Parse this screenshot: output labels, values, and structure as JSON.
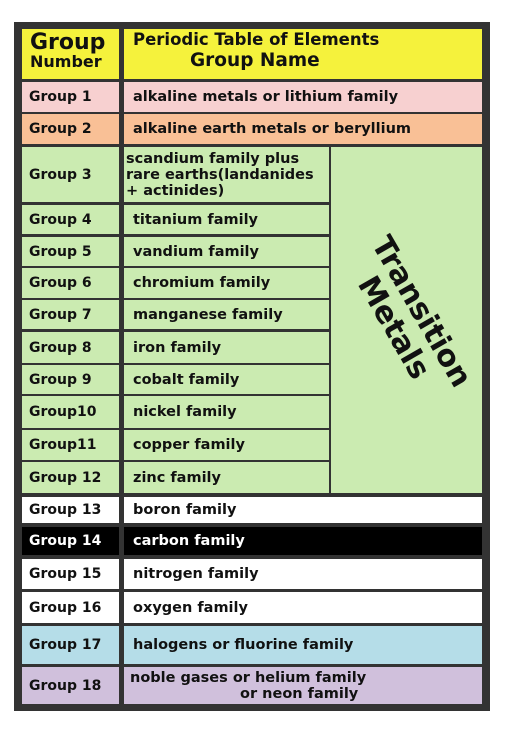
{
  "header": {
    "left_line1": "Group",
    "left_line2": "Number",
    "right_line1": "Periodic Table of Elements",
    "right_line2": "Group Name"
  },
  "transition_label": {
    "line1": "Transition",
    "line2": "Metals"
  },
  "colors": {
    "header": "#f5f23c",
    "group1": "#f7d0d0",
    "group2": "#f9c096",
    "transition": "#cbebb1",
    "white": "#ffffff",
    "group14": "#000000",
    "group17": "#b5dde8",
    "group18": "#d0c0dc",
    "frame": "#333333"
  },
  "rows": [
    {
      "group": "Group 1",
      "name": "alkaline metals or lithium family"
    },
    {
      "group": "Group 2",
      "name": "alkaline earth metals or beryllium"
    },
    {
      "group": "Group 3",
      "name": "scandium family plus",
      "name2": "rare earths(landanides",
      "name3": "+ actinides)"
    },
    {
      "group": "Group 4",
      "name": "titanium family"
    },
    {
      "group": "Group 5",
      "name": "vandium family"
    },
    {
      "group": "Group 6",
      "name": "chromium family"
    },
    {
      "group": "Group 7",
      "name": "manganese family"
    },
    {
      "group": "Group 8",
      "name": "iron family"
    },
    {
      "group": "Group 9",
      "name": "cobalt family"
    },
    {
      "group": "Group10",
      "name": "nickel family"
    },
    {
      "group": "Group11",
      "name": "copper family"
    },
    {
      "group": "Group 12",
      "name": "zinc family"
    },
    {
      "group": "Group 13",
      "name": "boron family"
    },
    {
      "group": "Group 14",
      "name": "carbon family"
    },
    {
      "group": "Group 15",
      "name": "nitrogen family"
    },
    {
      "group": "Group 16",
      "name": "oxygen family"
    },
    {
      "group": "Group 17",
      "name": "halogens or fluorine family"
    },
    {
      "group": "Group 18",
      "name": "noble gases or helium family",
      "name2": "or neon family"
    }
  ]
}
